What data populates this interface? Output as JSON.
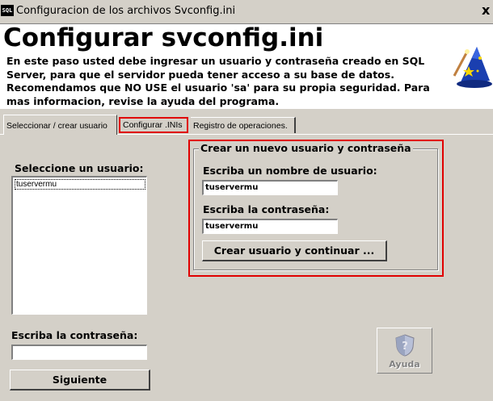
{
  "window": {
    "app_icon_text": "SQL",
    "title": "Configuracion de los archivos Svconfig.ini",
    "close_glyph": "x"
  },
  "header": {
    "title": "Configurar svconfig.ini",
    "description": "En este paso usted debe ingresar un usuario  y contraseña creado en SQL Server, para que el servidor pueda tener acceso a su base de datos. Recomendamos que NO USE el usuario 'sa' para su propia seguridad. Para mas informacion, revise la ayuda del programa.",
    "icon": "wizard-hat-icon"
  },
  "tabs": [
    {
      "label": "Seleccionar / crear usuario",
      "active": true
    },
    {
      "label": "Configurar .INIs",
      "highlighted": true
    },
    {
      "label": "Registro de operaciones."
    }
  ],
  "left_panel": {
    "select_label": "Seleccione un usuario:",
    "users": [
      "tuservermu"
    ],
    "password_label": "Escriba la contraseña:",
    "password_value": "",
    "next_button": "Siguiente"
  },
  "create_group": {
    "legend": "Crear un nuevo usuario y contraseña",
    "username_label": "Escriba un nombre de usuario:",
    "username_value": "tuservermu",
    "password_label": "Escriba la contraseña:",
    "password_value": "tuservermu",
    "create_button": "Crear usuario y continuar ..."
  },
  "help": {
    "label": "Ayuda",
    "icon": "shield-help-icon"
  },
  "colors": {
    "dialog_bg": "#d4d0c8",
    "highlight_red": "#e00000"
  }
}
